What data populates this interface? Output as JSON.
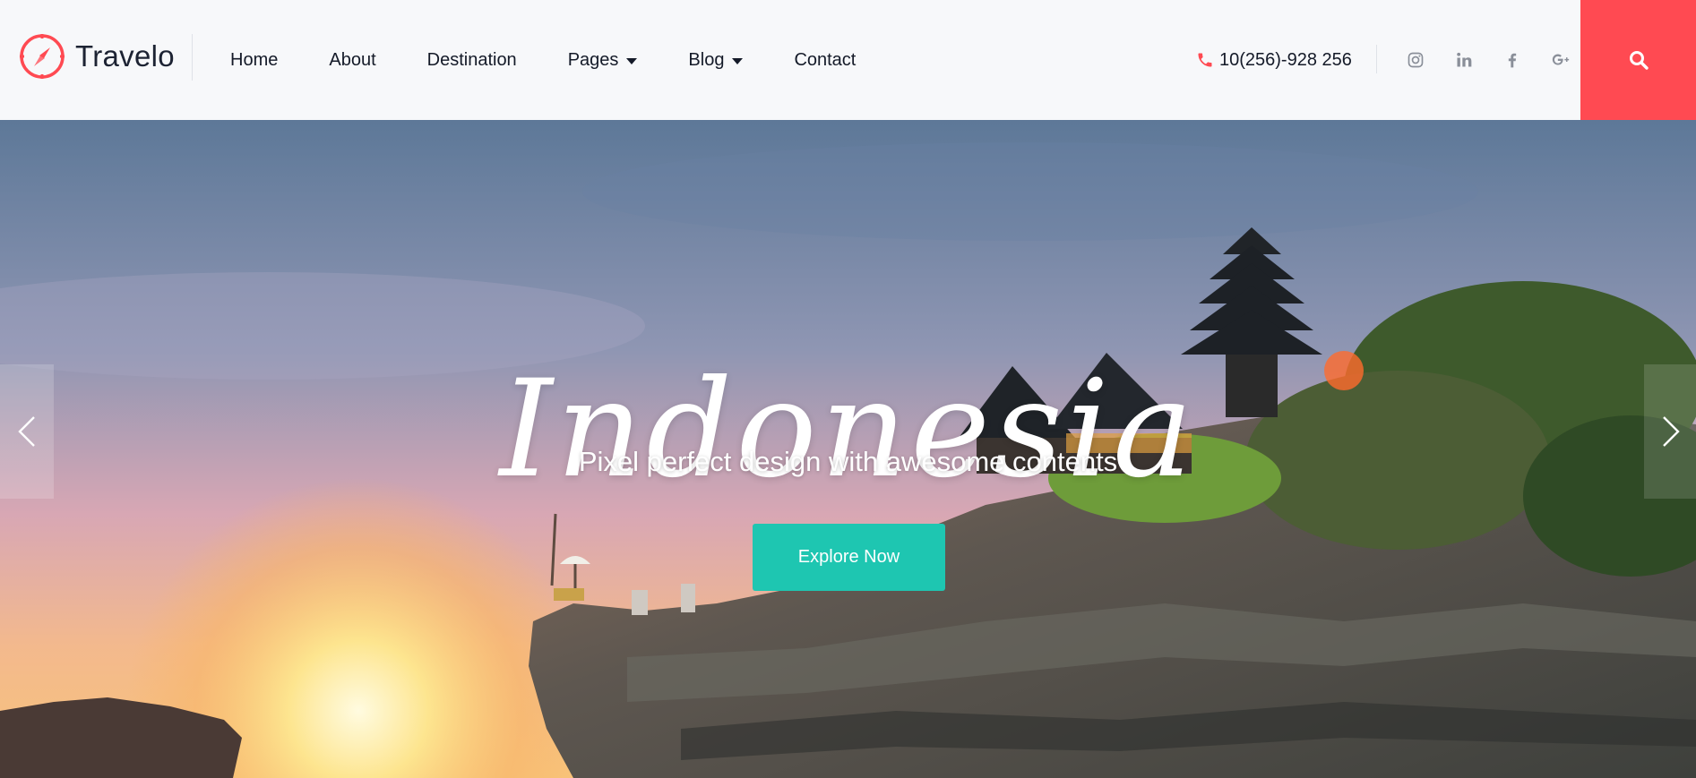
{
  "brand": {
    "name": "Travelo",
    "accent": "#ff4a52",
    "icon": "compass-icon"
  },
  "nav": {
    "items": [
      {
        "label": "Home",
        "has_dropdown": false
      },
      {
        "label": "About",
        "has_dropdown": false
      },
      {
        "label": "Destination",
        "has_dropdown": false
      },
      {
        "label": "Pages",
        "has_dropdown": true
      },
      {
        "label": "Blog",
        "has_dropdown": true
      },
      {
        "label": "Contact",
        "has_dropdown": false
      }
    ]
  },
  "contact": {
    "phone": "10(256)-928 256",
    "icon": "phone-icon"
  },
  "social": [
    "instagram-icon",
    "linkedin-icon",
    "facebook-icon",
    "google-plus-icon"
  ],
  "search": {
    "icon": "search-icon",
    "color": "#ff4a52"
  },
  "hero": {
    "title": "Indonesia",
    "subtitle": "Pixel perfect design with awesome contents",
    "cta_label": "Explore Now",
    "cta_color": "#1ec6b1"
  },
  "slider": {
    "prev_icon": "chevron-left-icon",
    "next_icon": "chevron-right-icon"
  }
}
